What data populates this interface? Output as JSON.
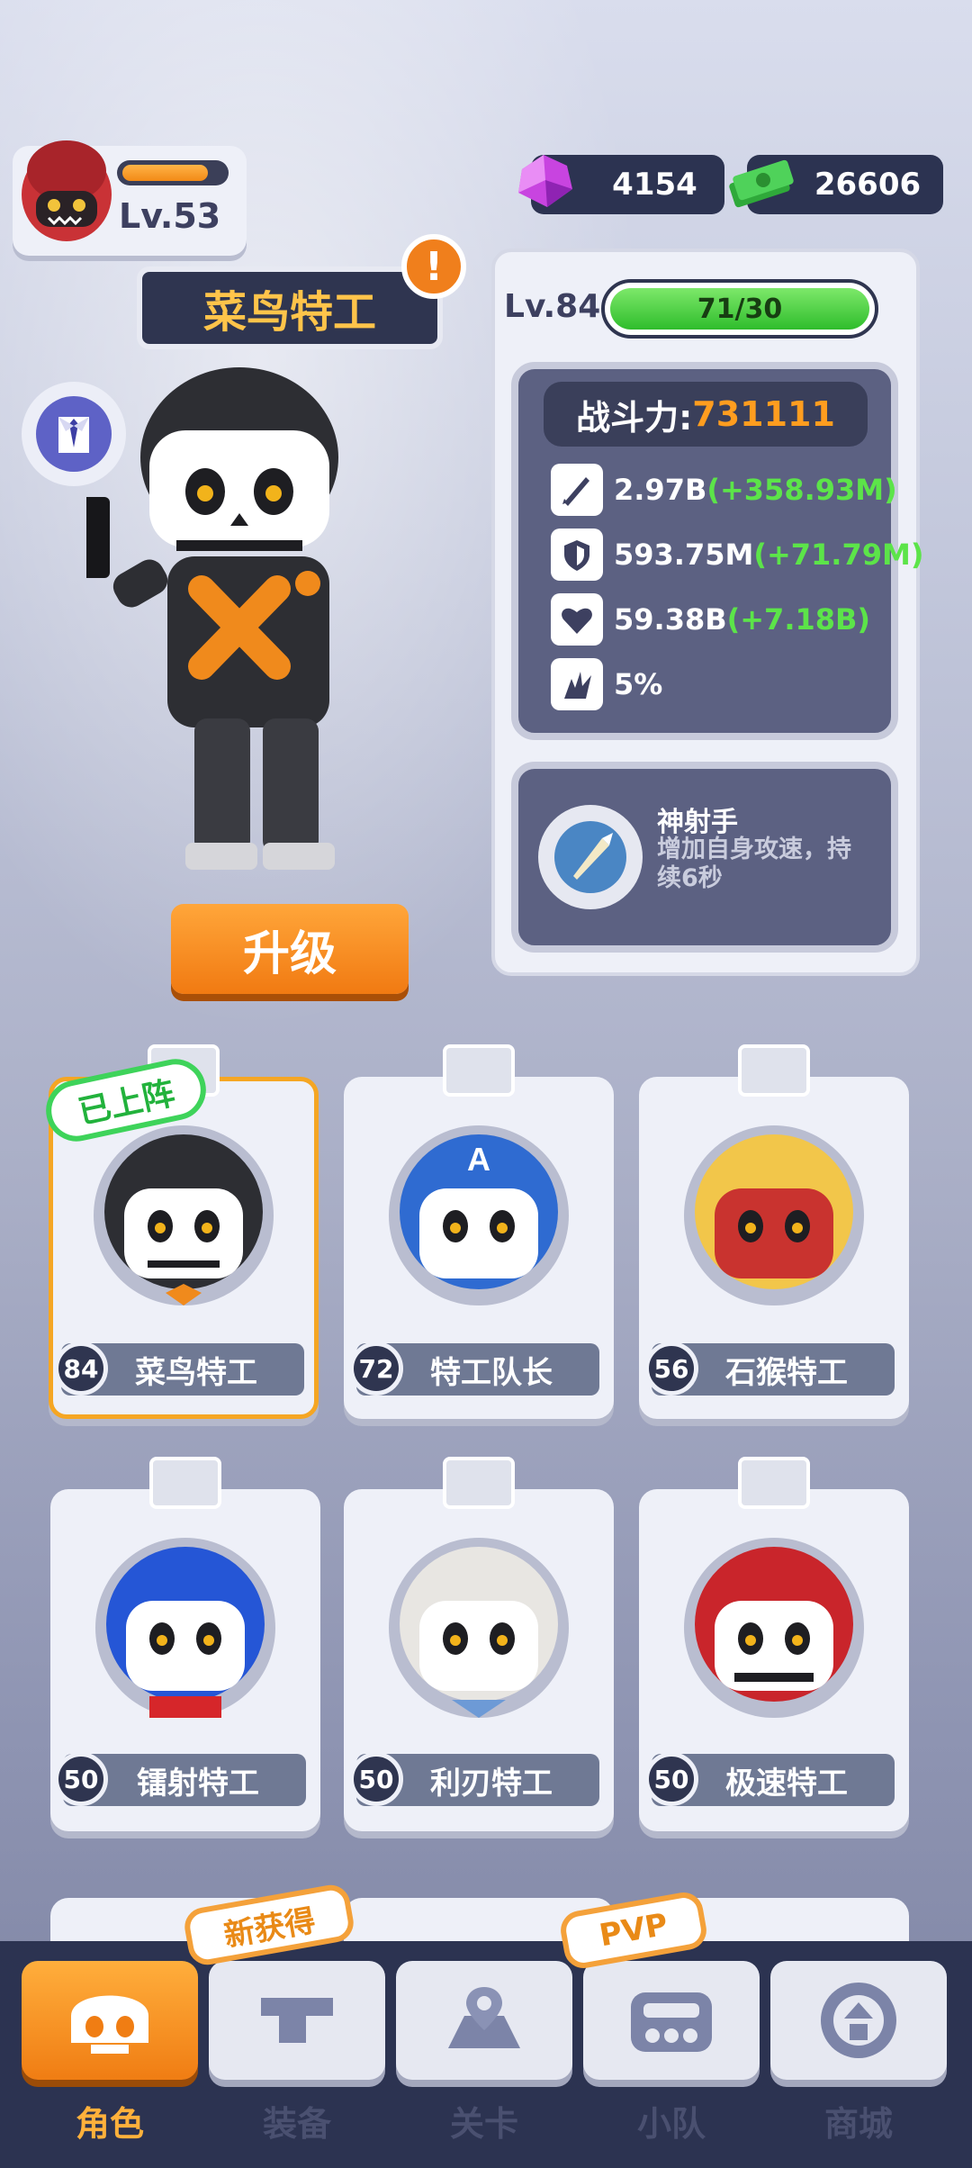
{
  "player": {
    "level": "Lv.53",
    "hp_fraction": 0.82
  },
  "currencies": {
    "gems": "4154",
    "cash": "26606"
  },
  "hero": {
    "name": "菜鸟特工",
    "alert": "!",
    "level": "Lv.84",
    "xp_text": "71/30",
    "power_label": "战斗力:",
    "power_value": "731111",
    "stats": [
      {
        "icon": "attack-icon",
        "value": "2.97B",
        "bonus": "(+358.93M)"
      },
      {
        "icon": "defense-icon",
        "value": "593.75M",
        "bonus": "(+71.79M)"
      },
      {
        "icon": "health-icon",
        "value": "59.38B",
        "bonus": "(+7.18B)"
      },
      {
        "icon": "crit-icon",
        "value": "5%",
        "bonus": ""
      }
    ],
    "skill": {
      "name": "神射手",
      "description": "增加自身攻速，持续6秒"
    },
    "upgrade_label": "升级"
  },
  "deployed_badge": "已上阵",
  "characters": [
    {
      "level": "84",
      "name": "菜鸟特工",
      "color": "#2d2d33",
      "selected": true
    },
    {
      "level": "72",
      "name": "特工队长",
      "color": "#2f6bd1",
      "selected": false
    },
    {
      "level": "56",
      "name": "石猴特工",
      "color": "#f2c64a",
      "selected": false
    },
    {
      "level": "50",
      "name": "镭射特工",
      "color": "#2556d6",
      "selected": false
    },
    {
      "level": "50",
      "name": "利刃特工",
      "color": "#e8e6e2",
      "selected": false
    },
    {
      "level": "50",
      "name": "极速特工",
      "color": "#c9252b",
      "selected": false
    }
  ],
  "nav": {
    "tabs": [
      {
        "label": "角色",
        "icon": "character-icon",
        "active": true
      },
      {
        "label": "装备",
        "icon": "equipment-icon",
        "active": false
      },
      {
        "label": "关卡",
        "icon": "map-icon",
        "active": false
      },
      {
        "label": "小队",
        "icon": "team-icon",
        "active": false
      },
      {
        "label": "商城",
        "icon": "shop-icon",
        "active": false
      }
    ],
    "tag_new": "新获得",
    "tag_pvp": "PVP"
  }
}
